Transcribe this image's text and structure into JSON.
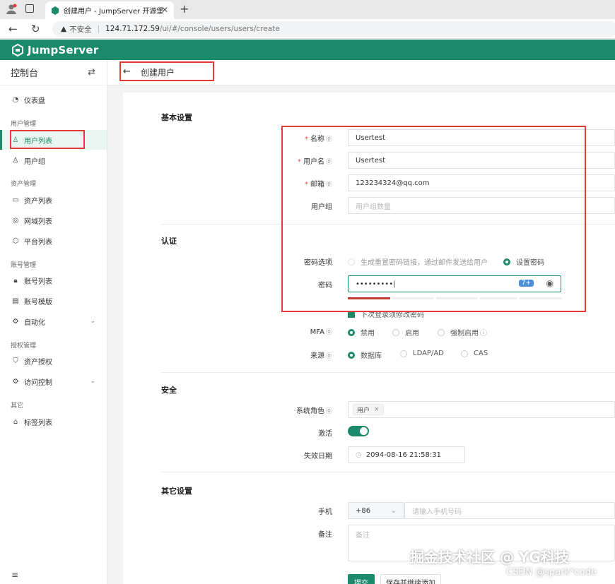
{
  "browser": {
    "tab_title": "创建用户 - JumpServer 开源堡垒",
    "insecure_label": "不安全",
    "url_host": "124.71.172.59",
    "url_path": "/ui/#/console/users/users/create"
  },
  "app": {
    "brand": "JumpServer",
    "brand_color": "#1b8a6b"
  },
  "sidebar": {
    "title": "控制台",
    "sections": {
      "user_mgmt": "用户管理",
      "asset_mgmt": "资产管理",
      "account_mgmt": "账号管理",
      "auth_mgmt": "授权管理",
      "other": "其它"
    },
    "items": {
      "dashboard": "仪表盘",
      "user_list": "用户列表",
      "user_group": "用户组",
      "asset_list": "资产列表",
      "domain_list": "网域列表",
      "platform_list": "平台列表",
      "account_list": "账号列表",
      "account_template": "账号模版",
      "automation": "自动化",
      "asset_perm": "资产授权",
      "access_control": "访问控制",
      "label_list": "标签列表"
    }
  },
  "page": {
    "title": "创建用户"
  },
  "form": {
    "basic_section": "基本设置",
    "name_label": "名称",
    "name_value": "Usertest",
    "username_label": "用户名",
    "username_value": "Usertest",
    "email_label": "邮箱",
    "email_value": "123234324@qq.com",
    "group_label": "用户组",
    "group_placeholder": "用户组数量",
    "auth_section": "认证",
    "pwd_option_label": "密码选项",
    "pwd_option_reset": "生成重置密码链接，通过邮件发送给用户",
    "pwd_option_set": "设置密码",
    "password_label": "密码",
    "password_mask": "•••••••••",
    "password_badge": "7+",
    "must_change_pwd": "下次登录须修改密码",
    "mfa_label": "MFA",
    "mfa_disabled": "禁用",
    "mfa_enabled": "启用",
    "mfa_forced": "强制启用",
    "source_label": "来源",
    "source_db": "数据库",
    "source_ldap": "LDAP/AD",
    "source_cas": "CAS",
    "security_section": "安全",
    "role_label": "系统角色",
    "role_tag": "用户",
    "active_label": "激活",
    "active_on": true,
    "expire_label": "失效日期",
    "expire_value": "2094-08-16 21:58:31",
    "other_section": "其它设置",
    "phone_label": "手机",
    "phone_code": "+86",
    "phone_placeholder": "请输入手机号码",
    "comment_label": "备注",
    "comment_placeholder": "备注",
    "submit": "提交",
    "save_continue": "保存并继续添加"
  },
  "watermark": {
    "main": "掘金技术社区 @ YG科技",
    "sub": "CSDN @spark*code"
  }
}
